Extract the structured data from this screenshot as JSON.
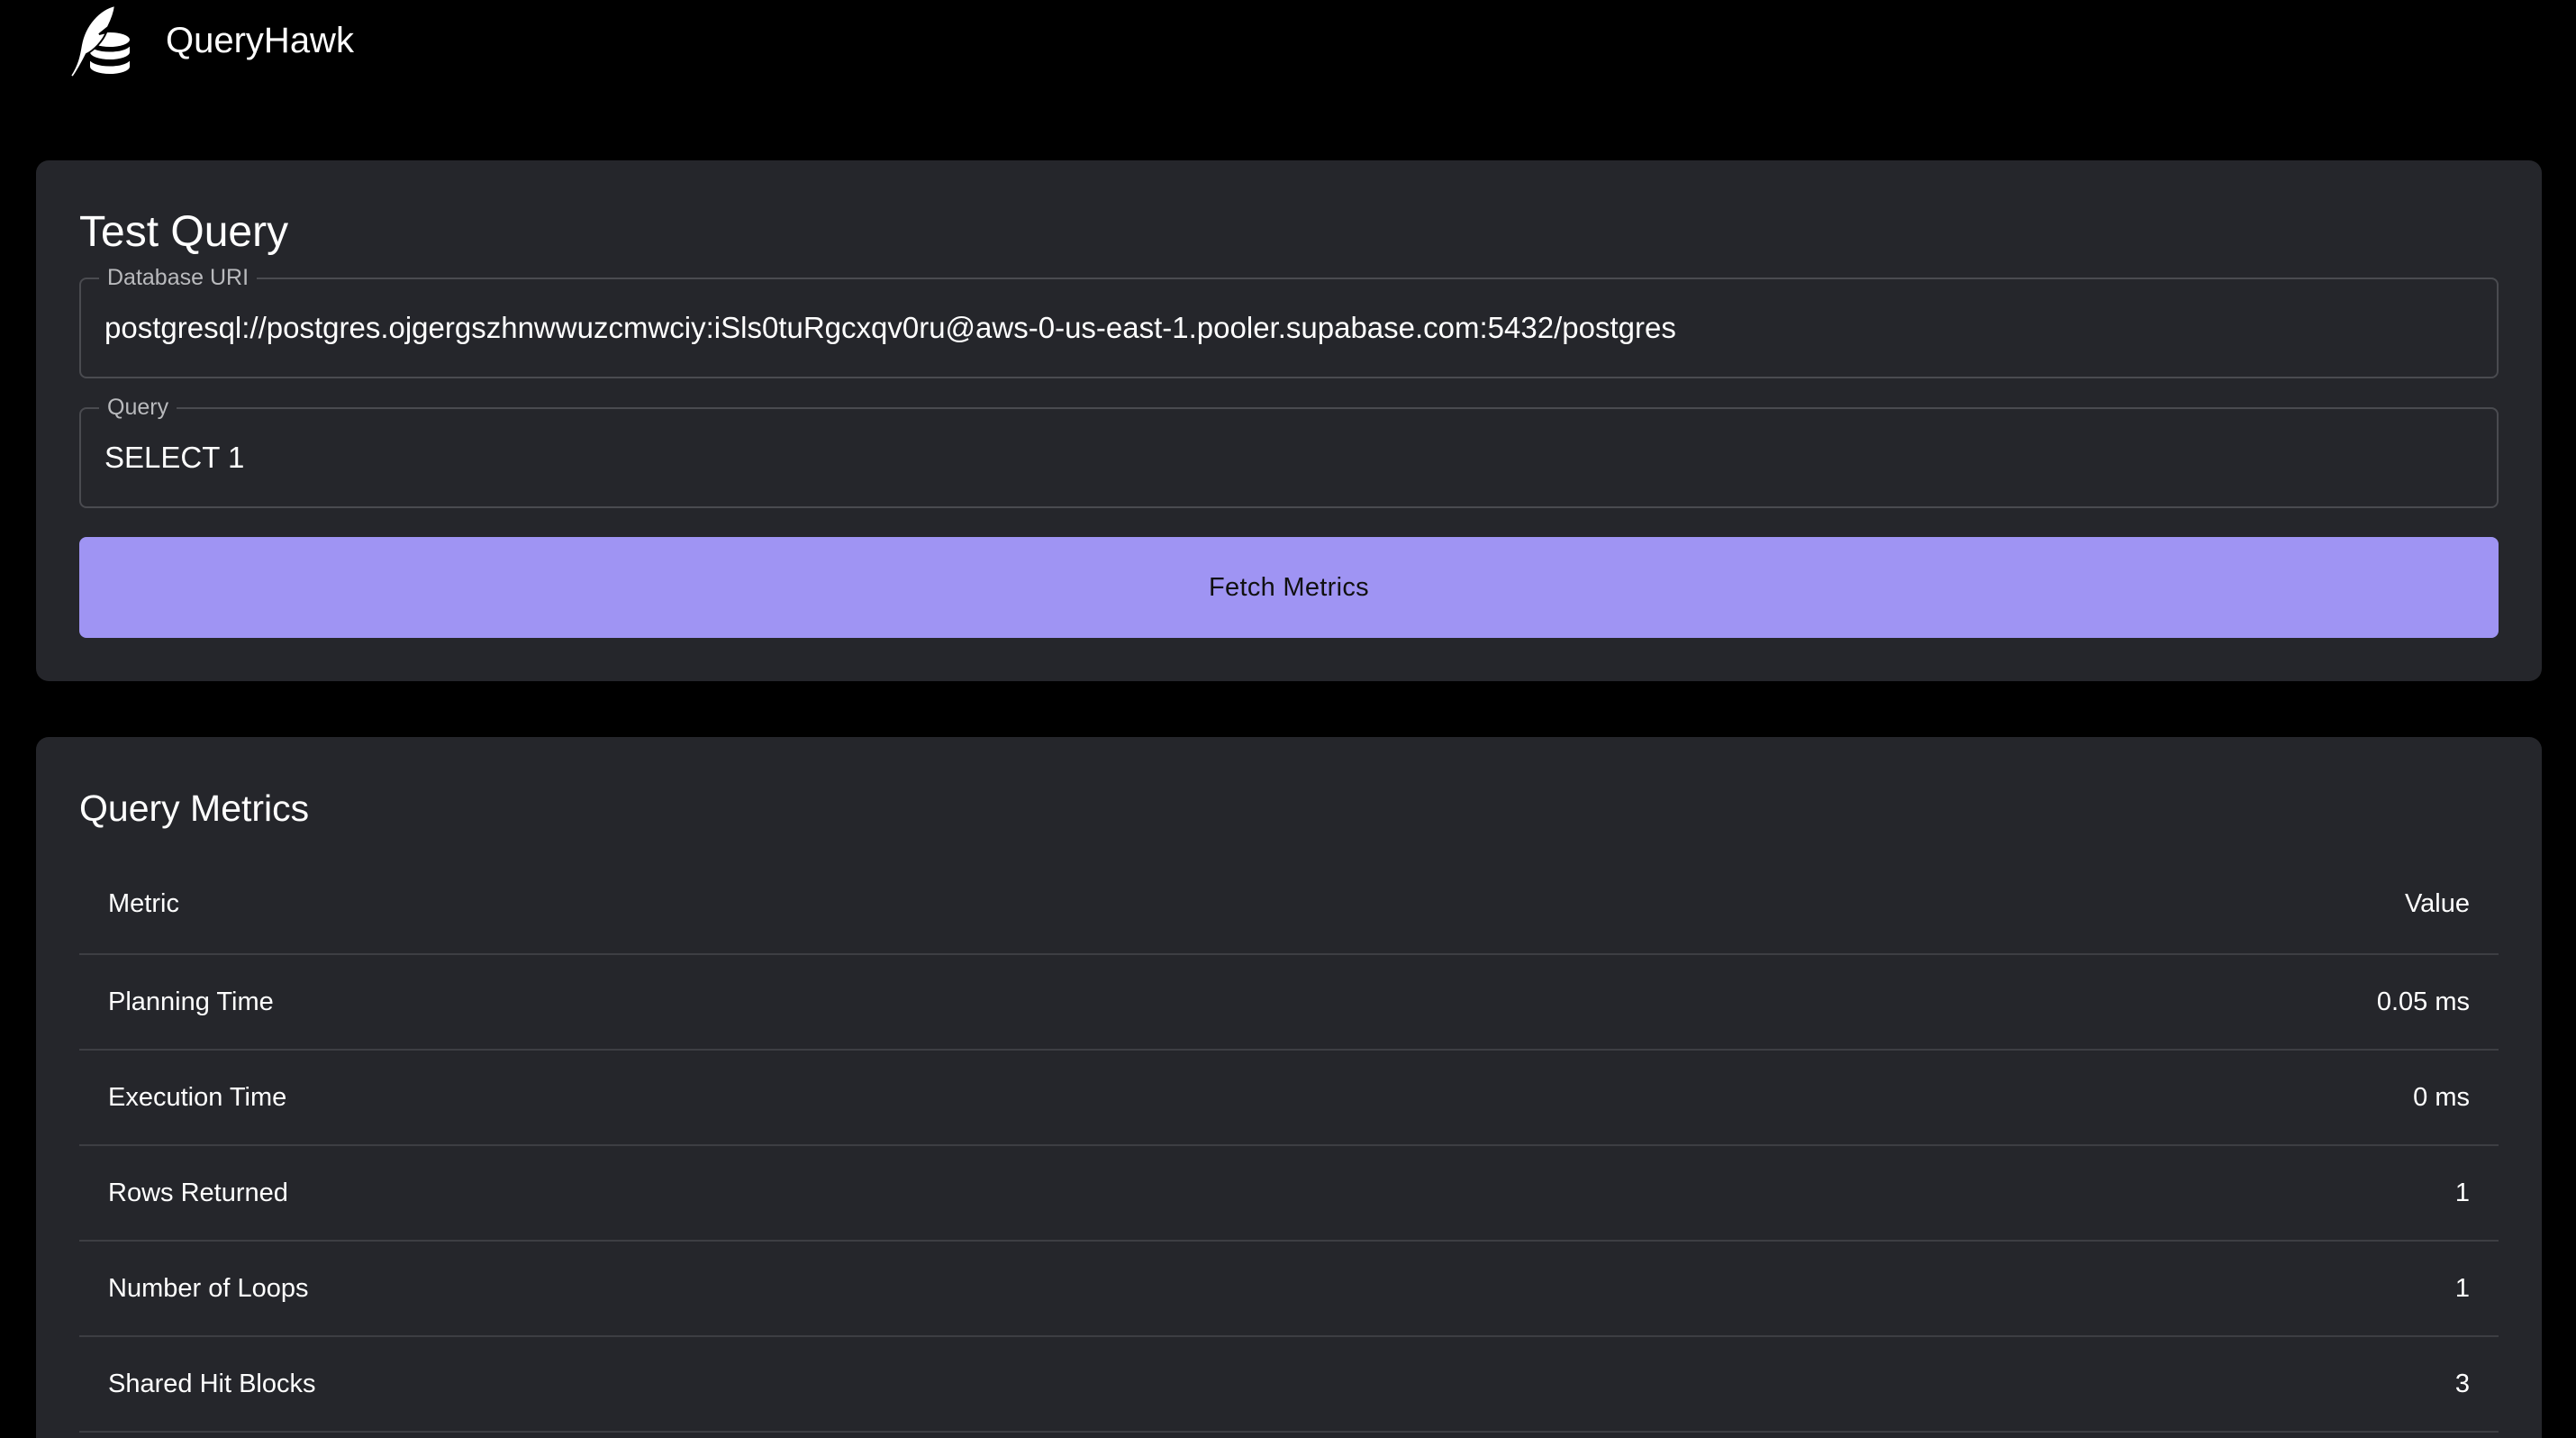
{
  "header": {
    "app_name": "QueryHawk",
    "logo_icon": "feather-database-icon"
  },
  "test_query": {
    "title": "Test Query",
    "database_uri": {
      "label": "Database URI",
      "value": "postgresql://postgres.ojgergszhnwwuzcmwciy:iSls0tuRgcxqv0ru@aws-0-us-east-1.pooler.supabase.com:5432/postgres"
    },
    "query": {
      "label": "Query",
      "value": "SELECT 1"
    },
    "fetch_button_label": "Fetch Metrics"
  },
  "query_metrics": {
    "title": "Query Metrics",
    "columns": {
      "metric": "Metric",
      "value": "Value"
    },
    "rows": [
      {
        "metric": "Planning Time",
        "value": "0.05 ms"
      },
      {
        "metric": "Execution Time",
        "value": "0 ms"
      },
      {
        "metric": "Rows Returned",
        "value": "1"
      },
      {
        "metric": "Number of Loops",
        "value": "1"
      },
      {
        "metric": "Shared Hit Blocks",
        "value": "3"
      }
    ]
  },
  "colors": {
    "background": "#000000",
    "card": "#25262b",
    "accent_button": "#9f94f3",
    "border": "#4a4b50"
  }
}
